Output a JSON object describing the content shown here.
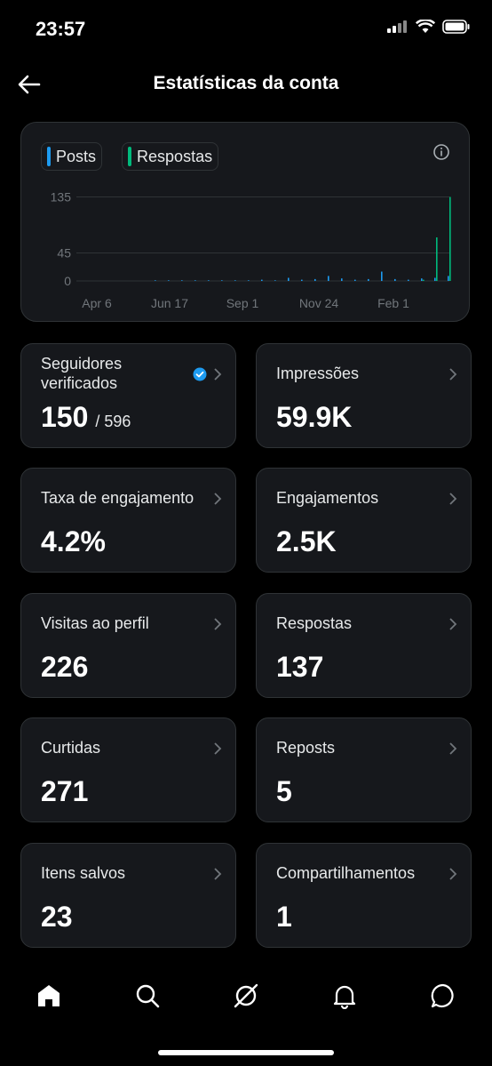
{
  "status_bar": {
    "time": "23:57"
  },
  "header": {
    "title": "Estatísticas da conta"
  },
  "chart": {
    "legend": [
      {
        "label": "Posts",
        "color": "#1d9bf0"
      },
      {
        "label": "Respostas",
        "color": "#00ba7c"
      }
    ]
  },
  "chart_data": {
    "type": "bar",
    "title": "",
    "xlabel": "",
    "ylabel": "",
    "y_ticks": [
      "135",
      "45",
      "0"
    ],
    "y_tick_values": [
      135,
      45,
      0
    ],
    "x_tick_labels": [
      "Apr 6",
      "Jun 17",
      "Sep 1",
      "Nov 24",
      "Feb 1"
    ],
    "ylim": [
      0,
      140
    ],
    "grid": true,
    "legend_position": "top-left",
    "series": [
      {
        "name": "Posts",
        "values": [
          1,
          1,
          1,
          1,
          1,
          1,
          1,
          1,
          2,
          1,
          5,
          2,
          3,
          8,
          4,
          2,
          3,
          15,
          3,
          2,
          4,
          5,
          8
        ]
      },
      {
        "name": "Respostas",
        "values": [
          0,
          0,
          0,
          0,
          0,
          0,
          0,
          0,
          0,
          0,
          0,
          0,
          0,
          0,
          0,
          0,
          0,
          0,
          0,
          0,
          2,
          70,
          135
        ]
      }
    ]
  },
  "stats": [
    {
      "label": "Seguidores verificados",
      "value": "150",
      "sub": "/ 596"
    },
    {
      "label": "Impressões",
      "value": "59.9K"
    },
    {
      "label": "Taxa de engajamento",
      "value": "4.2%"
    },
    {
      "label": "Engajamentos",
      "value": "2.5K"
    },
    {
      "label": "Visitas ao perfil",
      "value": "226"
    },
    {
      "label": "Respostas",
      "value": "137"
    },
    {
      "label": "Curtidas",
      "value": "271"
    },
    {
      "label": "Reposts",
      "value": "5"
    },
    {
      "label": "Itens salvos",
      "value": "23"
    },
    {
      "label": "Compartilhamentos",
      "value": "1"
    }
  ],
  "nav": {
    "items": [
      {
        "icon": "home-icon"
      },
      {
        "icon": "search-icon"
      },
      {
        "icon": "grok-icon"
      },
      {
        "icon": "bell-icon"
      },
      {
        "icon": "messages-icon"
      }
    ]
  }
}
